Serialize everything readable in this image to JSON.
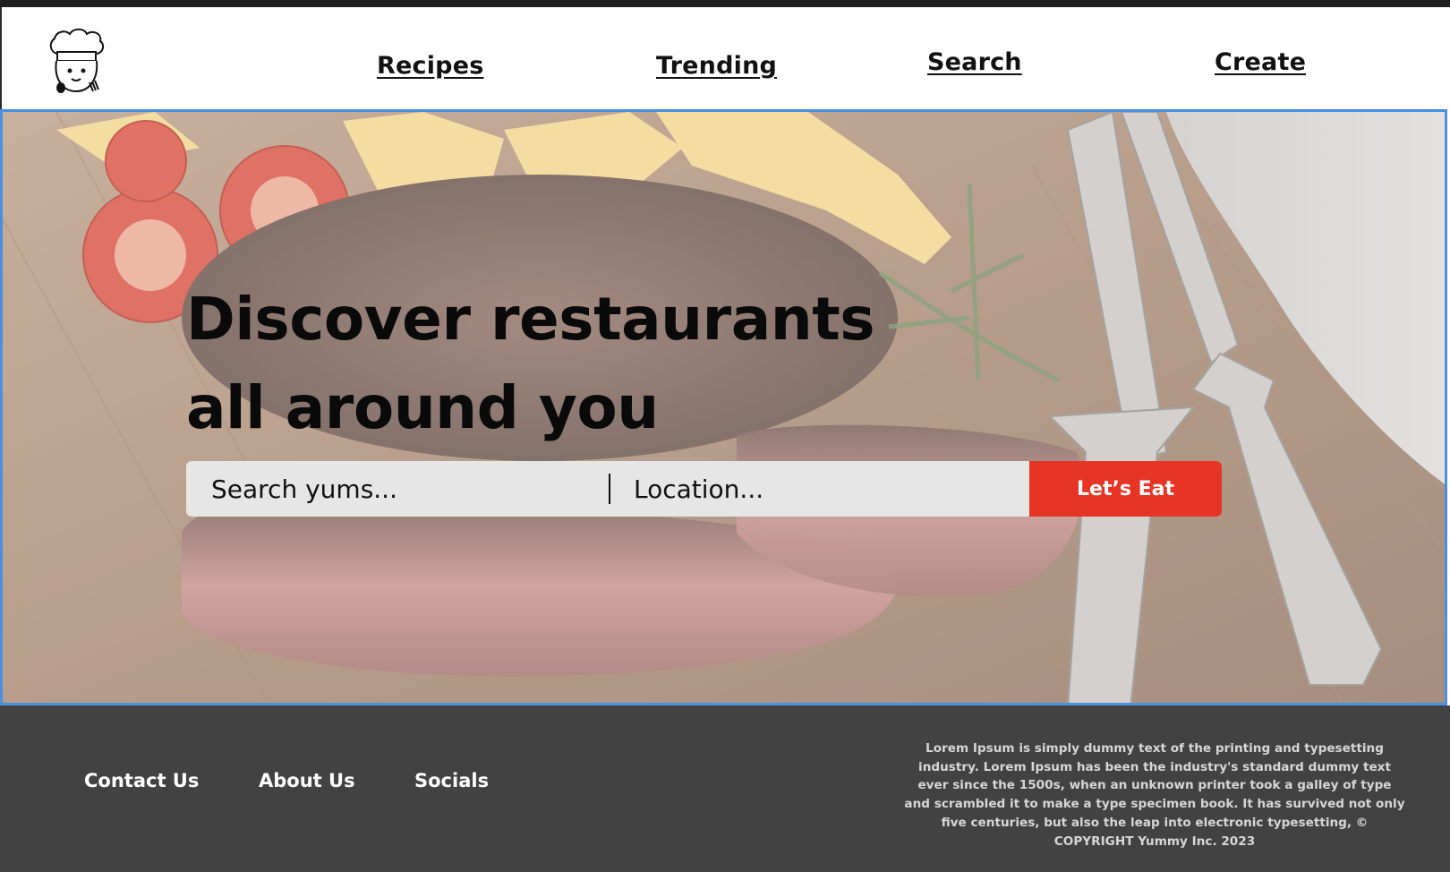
{
  "header": {
    "logo_icon": "chef-hat-icon",
    "nav": [
      {
        "label": "Recipes"
      },
      {
        "label": "Trending"
      },
      {
        "label": "Search"
      },
      {
        "label": "Create"
      }
    ]
  },
  "hero": {
    "title_line1": "Discover restaurants",
    "title_line2": "all around you",
    "search_placeholder": "Search yums...",
    "location_placeholder": "Location...",
    "cta_label": "Let’s Eat",
    "background": "steak-on-cutting-board-image"
  },
  "footer": {
    "links": [
      {
        "label": "Contact Us"
      },
      {
        "label": "About Us"
      },
      {
        "label": "Socials"
      }
    ],
    "text": "Lorem Ipsum is simply dummy text of the printing and typesetting industry. Lorem Ipsum has been the industry's standard dummy text ever since the 1500s, when an unknown printer took a galley of type and scrambled it to make a type specimen book. It has survived not only five centuries, but also the leap into electronic typesetting,  © COPYRIGHT Yummy Inc. 2023"
  },
  "colors": {
    "accent": "#e63425",
    "footer_bg": "#424242",
    "hero_border": "#4a90e2",
    "search_bg": "#e6e6e6"
  }
}
